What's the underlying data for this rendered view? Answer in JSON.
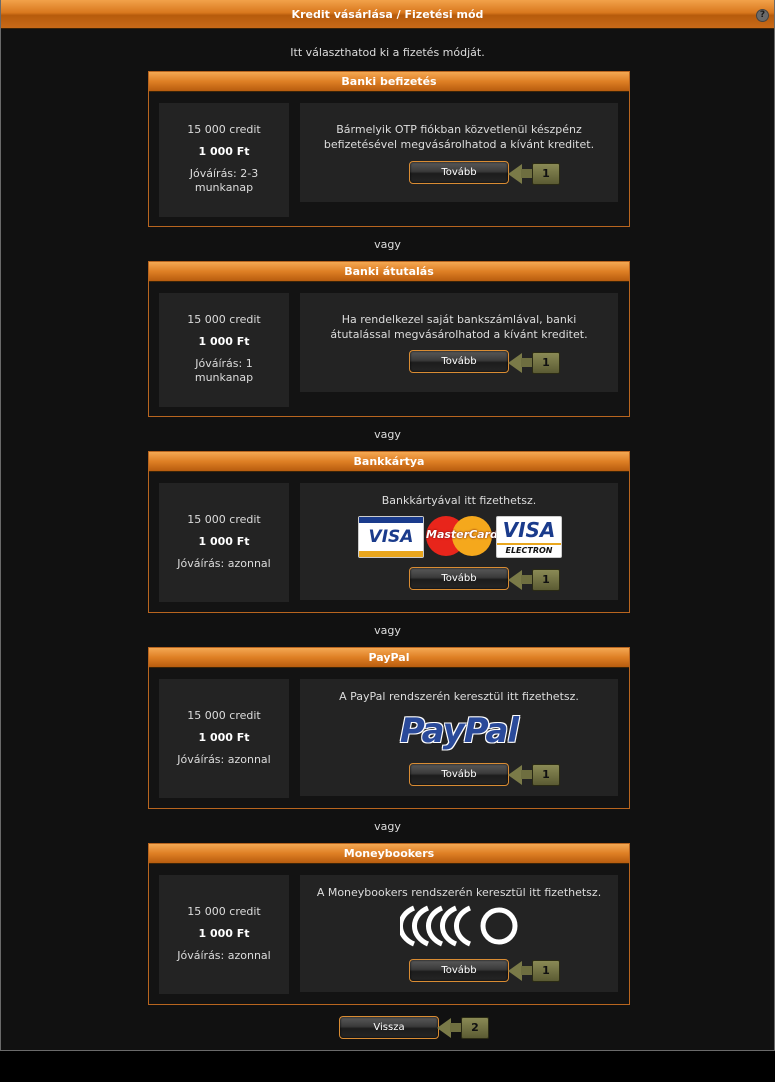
{
  "window": {
    "title": "Kredit vásárlása / Fizetési mód",
    "help": "?"
  },
  "intro": "Itt választhatod ki a fizetés módját.",
  "separator": "vagy",
  "sections": [
    {
      "title": "Banki befizetés",
      "credit": "15 000 credit",
      "price": "1 000 Ft",
      "jovairas": "Jóváírás: 2-3 munkanap",
      "description": "Bármelyik OTP fiókban közvetlenül készpénz befizetésével megvásárolhatod a kívánt kreditet.",
      "button": "Tovább",
      "key": "1"
    },
    {
      "title": "Banki átutalás",
      "credit": "15 000 credit",
      "price": "1 000 Ft",
      "jovairas": "Jóváírás: 1 munkanap",
      "description": "Ha rendelkezel saját bankszámlával, banki átutalással megvásárolhatod a kívánt kreditet.",
      "button": "Tovább",
      "key": "1"
    },
    {
      "title": "Bankkártya",
      "credit": "15 000 credit",
      "price": "1 000 Ft",
      "jovairas": "Jóváírás: azonnal",
      "description": "Bankkártyával itt fizethetsz.",
      "logos": {
        "visa": "VISA",
        "mastercard": "MasterCard",
        "visa_electron": "VISA",
        "electron": "ELECTRON"
      },
      "button": "Tovább",
      "key": "1"
    },
    {
      "title": "PayPal",
      "credit": "15 000 credit",
      "price": "1 000 Ft",
      "jovairas": "Jóváírás: azonnal",
      "description": "A PayPal rendszerén keresztül itt fizethetsz.",
      "logo": "PayPal",
      "button": "Tovább",
      "key": "1"
    },
    {
      "title": "Moneybookers",
      "credit": "15 000 credit",
      "price": "1 000 Ft",
      "jovairas": "Jóváírás: azonnal",
      "description": "A Moneybookers rendszerén keresztül itt fizethetsz.",
      "button": "Tovább",
      "key": "1"
    }
  ],
  "back": {
    "label": "Vissza",
    "key": "2"
  },
  "colors": {
    "accent": "#de7f24",
    "border": "#b8651f",
    "panel": "#232323"
  }
}
